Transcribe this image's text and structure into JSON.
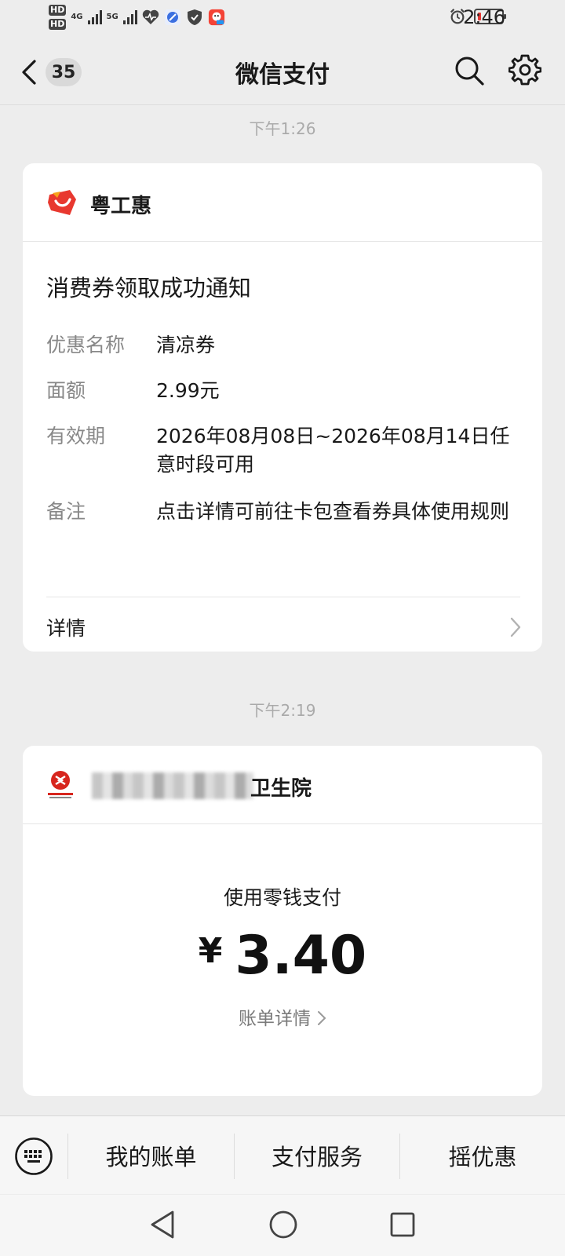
{
  "status_bar": {
    "hd_top": "HD",
    "hd_bottom": "HD",
    "net1": "4G",
    "net2": "5G",
    "time": "2:46",
    "icons": [
      "health-icon",
      "browser-icon",
      "shield-icon",
      "app-icon",
      "alarm-icon",
      "battery-low-icon"
    ]
  },
  "nav": {
    "back_icon": "chevron-left-icon",
    "unread_count": "35",
    "title": "微信支付",
    "search_icon": "search-icon",
    "settings_icon": "gear-icon"
  },
  "messages": [
    {
      "timestamp": "下午1:26",
      "brand": {
        "name": "粤工惠",
        "logo": "yuegonghui-logo",
        "color": "#e8382f"
      },
      "title": "消费券领取成功通知",
      "fields": [
        {
          "label": "优惠名称",
          "value": "清凉券"
        },
        {
          "label": "面额",
          "value": "2.99元"
        },
        {
          "label": "有效期",
          "value": "2026年08月08日~2026年08月14日任意时段可用"
        },
        {
          "label": "备注",
          "value": "点击详情可前往卡包查看券具体使用规则"
        }
      ],
      "detail_label": "详情"
    },
    {
      "timestamp": "下午2:19",
      "merchant": {
        "name_visible": "卫生院",
        "logo": "bank-logo",
        "color": "#d7261e"
      },
      "pay_method": "使用零钱支付",
      "currency": "¥",
      "amount": "3.40",
      "bill_detail": "账单详情"
    }
  ],
  "bottom_menu": {
    "keyboard_icon": "keyboard-icon",
    "items": [
      "我的账单",
      "支付服务",
      "摇优惠"
    ]
  },
  "system_nav": [
    "back-triangle-icon",
    "home-circle-icon",
    "recents-square-icon"
  ]
}
